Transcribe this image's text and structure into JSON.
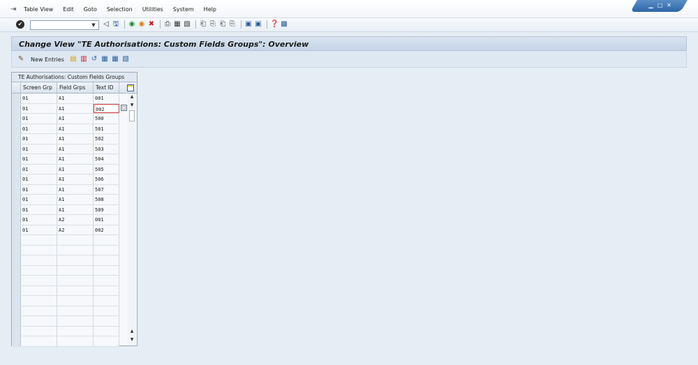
{
  "menu": {
    "items": [
      {
        "label": "Table View"
      },
      {
        "label": "Edit"
      },
      {
        "label": "Goto"
      },
      {
        "label": "Selection"
      },
      {
        "label": "Utilities"
      },
      {
        "label": "System"
      },
      {
        "label": "Help"
      }
    ]
  },
  "toolbar": {
    "command_value": ""
  },
  "title": "Change View \"TE Authorisations: Custom Fields Groups\": Overview",
  "app_toolbar": {
    "new_entries": "New Entries"
  },
  "table": {
    "title": "TE Authorisations: Custom Fields Groups",
    "columns": [
      "Screen Grp",
      "Field Grps",
      "Text ID"
    ],
    "rows": [
      [
        "01",
        "A1",
        "001"
      ],
      [
        "01",
        "A1",
        "002"
      ],
      [
        "01",
        "A1",
        "500"
      ],
      [
        "01",
        "A1",
        "501"
      ],
      [
        "01",
        "A1",
        "502"
      ],
      [
        "01",
        "A1",
        "503"
      ],
      [
        "01",
        "A1",
        "504"
      ],
      [
        "01",
        "A1",
        "505"
      ],
      [
        "01",
        "A1",
        "506"
      ],
      [
        "01",
        "A1",
        "507"
      ],
      [
        "01",
        "A1",
        "508"
      ],
      [
        "01",
        "A1",
        "509"
      ],
      [
        "01",
        "A2",
        "001"
      ],
      [
        "01",
        "A2",
        "002"
      ]
    ],
    "empty_rows": 11,
    "focused_row": 1
  },
  "colors": {
    "background": "#e6eef5",
    "title_bar": "#c5d5e6",
    "window_controls": "#2e66a8",
    "focus_border": "#d13a3a"
  }
}
